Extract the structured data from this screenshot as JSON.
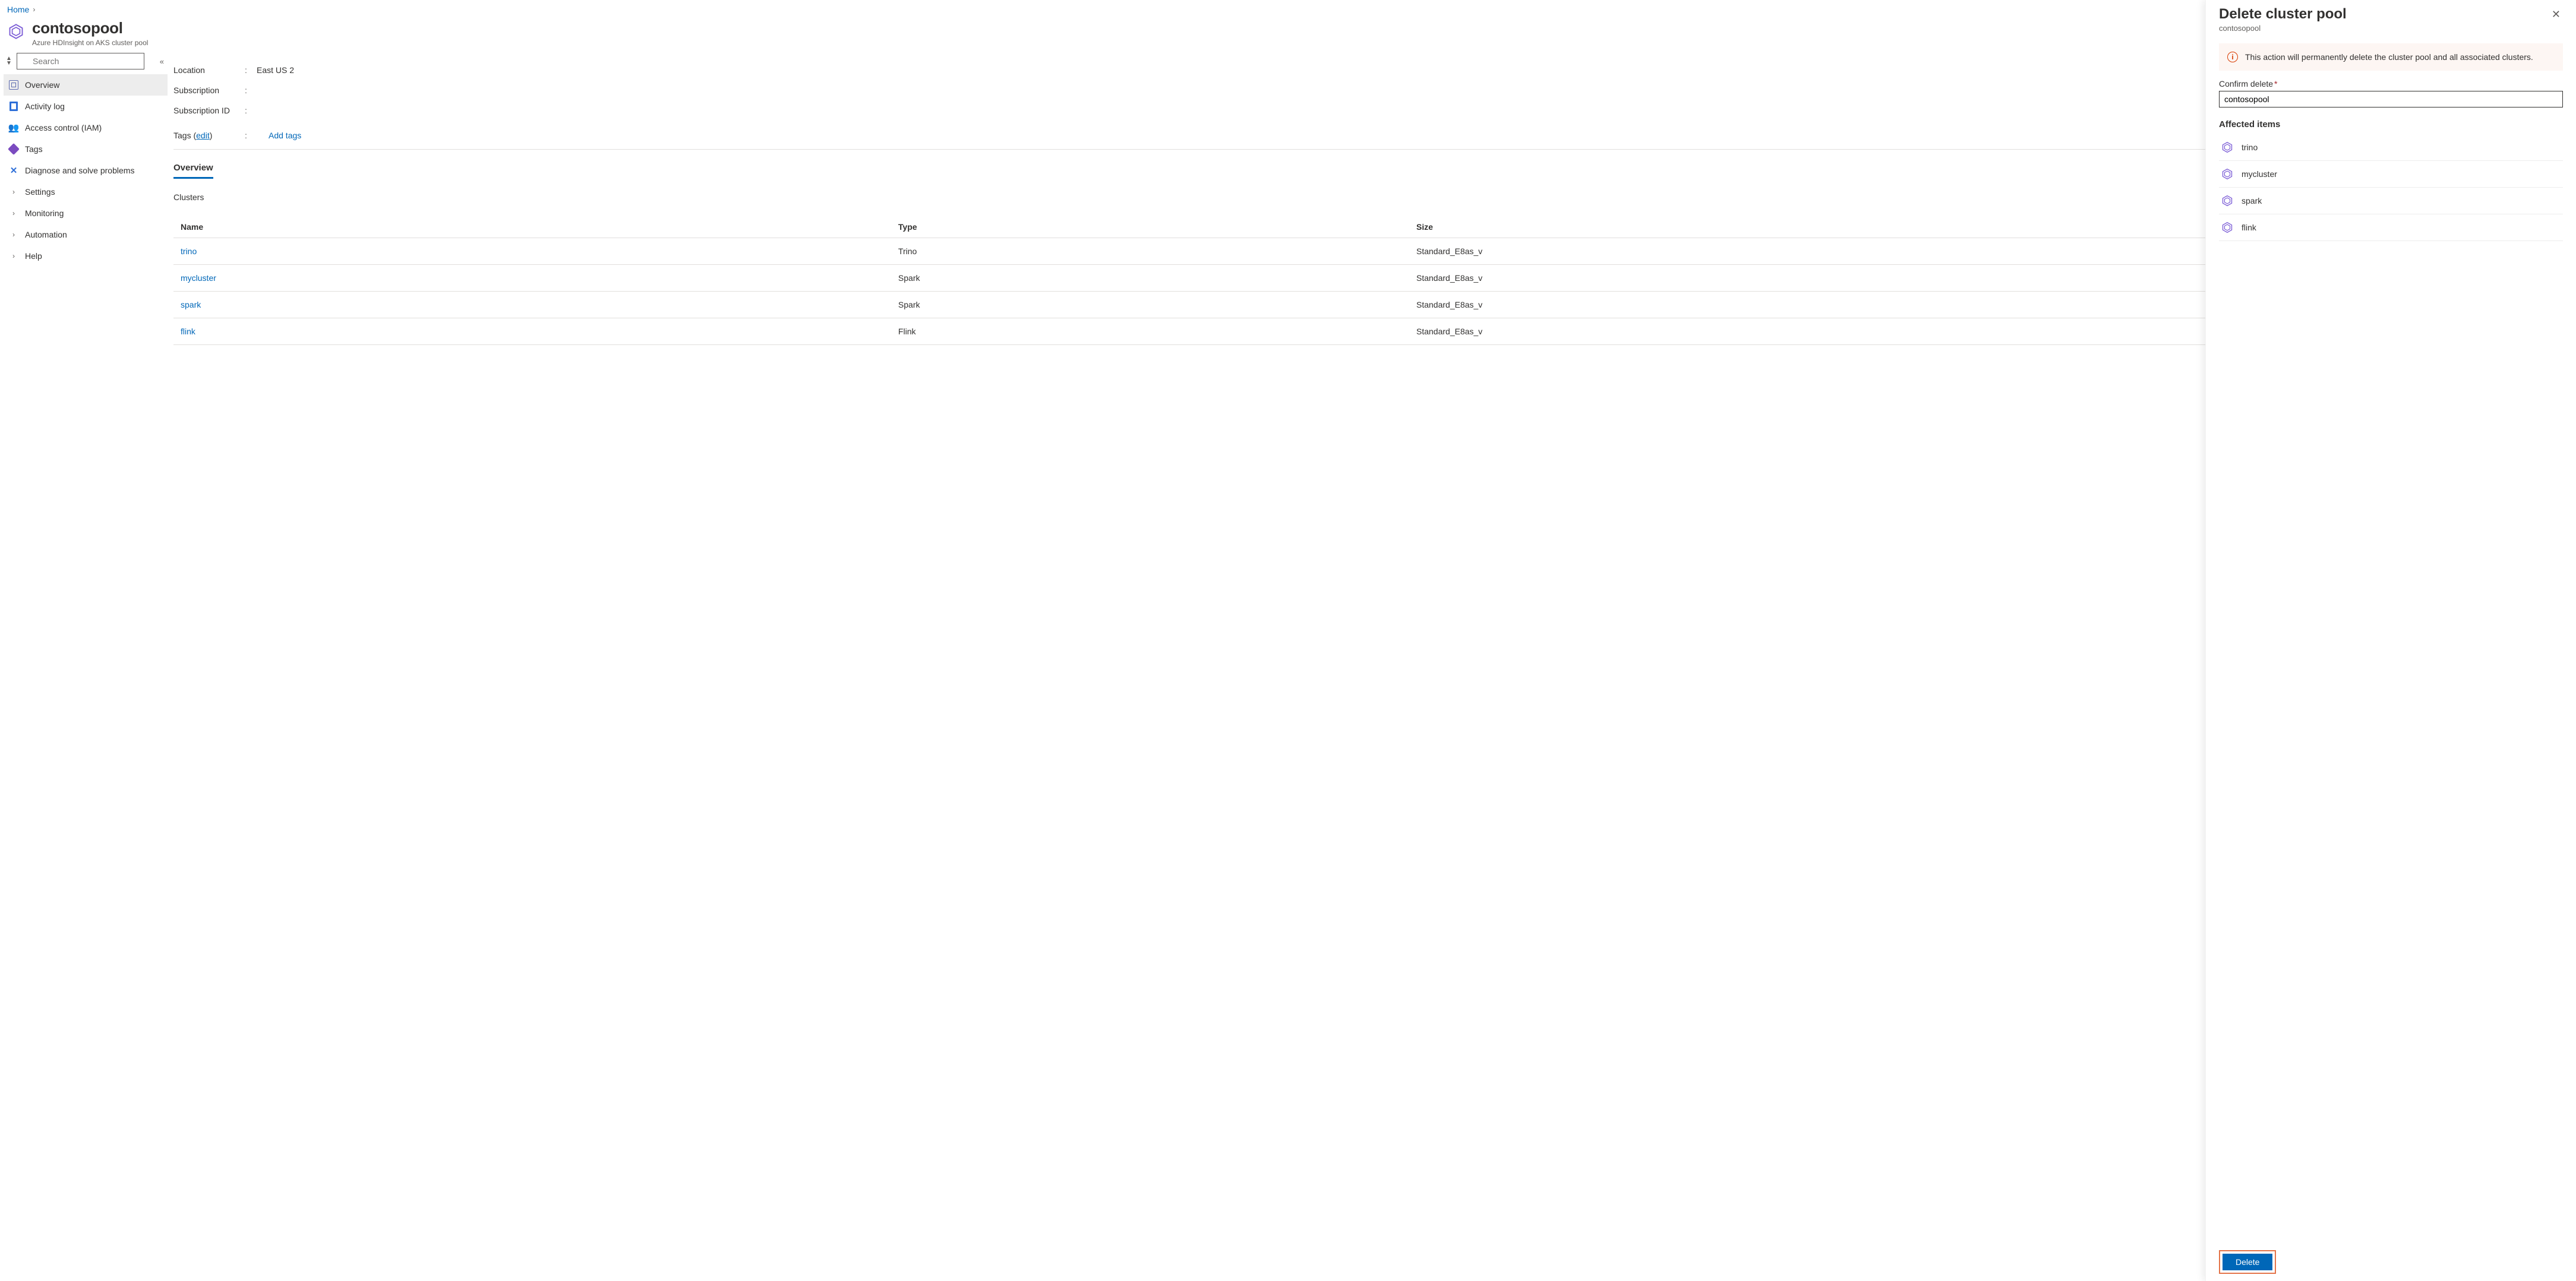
{
  "breadcrumb": {
    "home": "Home"
  },
  "resource": {
    "title": "contosopool",
    "subtype": "Azure HDInsight on AKS cluster pool"
  },
  "search": {
    "placeholder": "Search"
  },
  "sidebar": {
    "items": [
      {
        "label": "Overview",
        "icon": "overview",
        "selected": true
      },
      {
        "label": "Activity log",
        "icon": "log"
      },
      {
        "label": "Access control (IAM)",
        "icon": "iam"
      },
      {
        "label": "Tags",
        "icon": "tags"
      },
      {
        "label": "Diagnose and solve problems",
        "icon": "diag"
      },
      {
        "label": "Settings",
        "icon": "chev"
      },
      {
        "label": "Monitoring",
        "icon": "chev"
      },
      {
        "label": "Automation",
        "icon": "chev"
      },
      {
        "label": "Help",
        "icon": "chev"
      }
    ]
  },
  "essentials": {
    "location_k": "Location",
    "location_v": "East US 2",
    "subscription_k": "Subscription",
    "subscription_v": "",
    "subid_k": "Subscription ID",
    "subid_v": "",
    "tags_k": "Tags",
    "edit": "edit",
    "addtags": "Add tags"
  },
  "tabs": {
    "overview": "Overview"
  },
  "clusters": {
    "heading": "Clusters",
    "cols": {
      "name": "Name",
      "type": "Type",
      "size": "Size"
    },
    "rows": [
      {
        "name": "trino",
        "type": "Trino",
        "size": "Standard_E8as_v"
      },
      {
        "name": "mycluster",
        "type": "Spark",
        "size": "Standard_E8as_v"
      },
      {
        "name": "spark",
        "type": "Spark",
        "size": "Standard_E8as_v"
      },
      {
        "name": "flink",
        "type": "Flink",
        "size": "Standard_E8as_v"
      }
    ]
  },
  "panel": {
    "title": "Delete cluster pool",
    "sub": "contosopool",
    "warning": "This action will permanently delete the cluster pool and all associated clusters.",
    "confirm_label": "Confirm delete",
    "confirm_value": "contosopool",
    "affected_title": "Affected items",
    "affected": [
      "trino",
      "mycluster",
      "spark",
      "flink"
    ],
    "delete_btn": "Delete"
  }
}
